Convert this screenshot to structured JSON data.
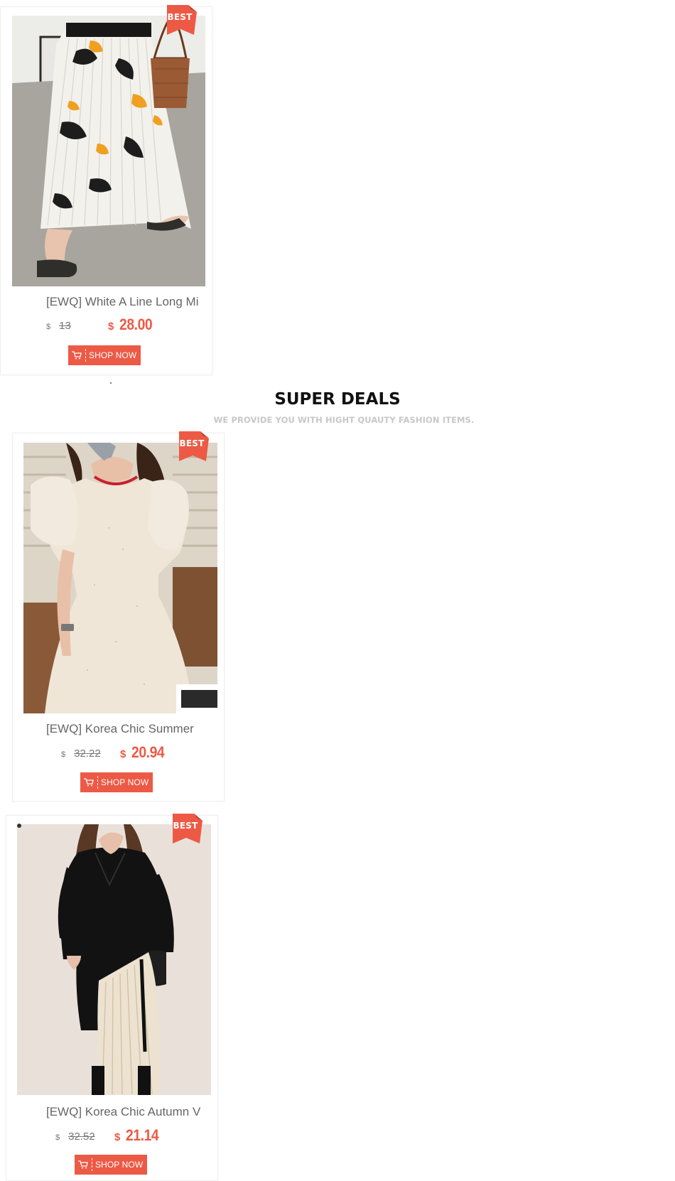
{
  "section": {
    "title": "SUPER DEALS",
    "subtitle": "WE PROVIDE YOU WITH HIGHT QUAUTY FASHION ITEMS."
  },
  "colors": {
    "accent": "#ec5a45",
    "title_text": "#666666",
    "subtitle_text": "#c8c8c8"
  },
  "products": [
    {
      "badge": "BEST",
      "title": "[EWQ] White A Line Long Mi",
      "old_currency": "$",
      "old_price": "13",
      "new_currency": "$",
      "new_price": "28.00",
      "button_label": "SHOP NOW",
      "button_icon": "cart-icon"
    },
    {
      "badge": "BEST",
      "title": "[EWQ] Korea Chic Summer",
      "old_currency": "$",
      "old_price": "32.22",
      "new_currency": "$",
      "new_price": "20.94",
      "button_label": "SHOP NOW",
      "button_icon": "cart-icon"
    },
    {
      "badge": "BEST",
      "title": "[EWQ] Korea Chic Autumn V",
      "old_currency": "$",
      "old_price": "32.52",
      "new_currency": "$",
      "new_price": "21.14",
      "button_label": "SHOP NOW",
      "button_icon": "cart-icon"
    }
  ]
}
